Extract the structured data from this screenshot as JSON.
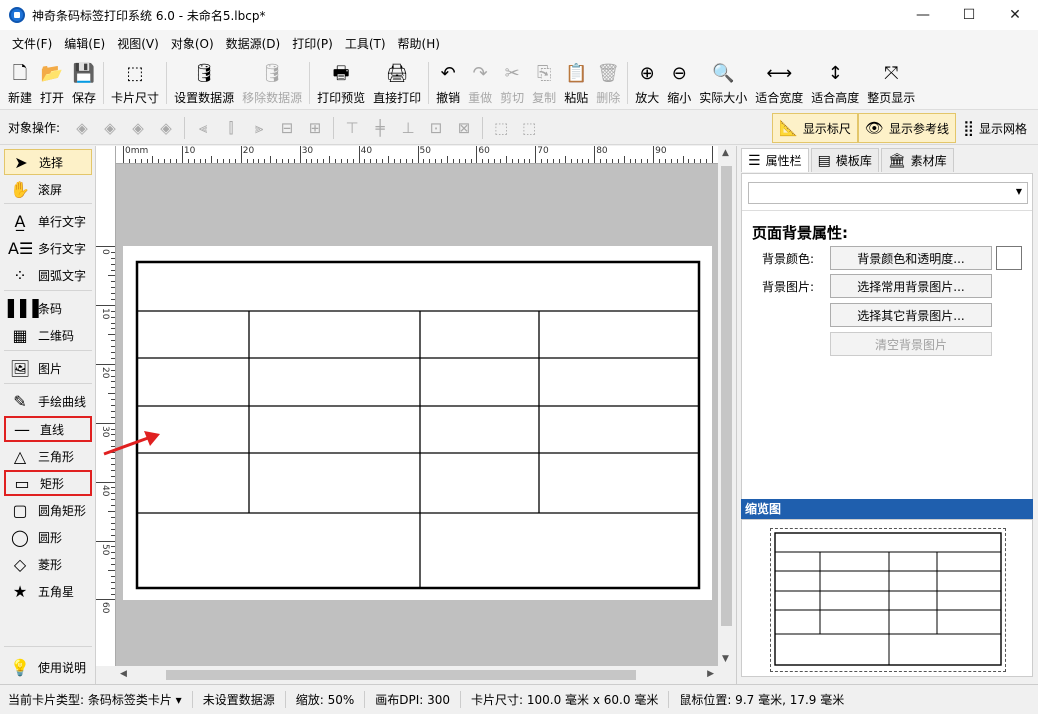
{
  "window": {
    "title": "神奇条码标签打印系统 6.0 - 未命名5.lbcp*",
    "minimize": "—",
    "maximize": "☐",
    "close": "✕"
  },
  "menu": [
    "文件(F)",
    "编辑(E)",
    "视图(V)",
    "对象(O)",
    "数据源(D)",
    "打印(P)",
    "工具(T)",
    "帮助(H)"
  ],
  "toolbar": [
    {
      "label": "新建",
      "icon": "new-file-icon",
      "glyph": "🗋",
      "enabled": true
    },
    {
      "label": "打开",
      "icon": "open-folder-icon",
      "glyph": "📂",
      "enabled": true
    },
    {
      "label": "保存",
      "icon": "save-icon",
      "glyph": "💾",
      "enabled": true
    },
    {
      "label": "卡片尺寸",
      "icon": "card-size-icon",
      "glyph": "⬚",
      "enabled": true
    },
    {
      "label": "设置数据源",
      "icon": "database-icon",
      "glyph": "🛢",
      "enabled": true
    },
    {
      "label": "移除数据源",
      "icon": "remove-database-icon",
      "glyph": "🛢",
      "enabled": false
    },
    {
      "label": "打印预览",
      "icon": "print-preview-icon",
      "glyph": "🖶",
      "enabled": true
    },
    {
      "label": "直接打印",
      "icon": "printer-icon",
      "glyph": "🖨",
      "enabled": true
    },
    {
      "label": "撤销",
      "icon": "undo-icon",
      "glyph": "↶",
      "enabled": true
    },
    {
      "label": "重做",
      "icon": "redo-icon",
      "glyph": "↷",
      "enabled": false
    },
    {
      "label": "剪切",
      "icon": "cut-icon",
      "glyph": "✂",
      "enabled": false
    },
    {
      "label": "复制",
      "icon": "copy-icon",
      "glyph": "⎘",
      "enabled": false
    },
    {
      "label": "粘贴",
      "icon": "paste-icon",
      "glyph": "📋",
      "enabled": true
    },
    {
      "label": "删除",
      "icon": "delete-icon",
      "glyph": "🗑",
      "enabled": false
    },
    {
      "label": "放大",
      "icon": "zoom-in-icon",
      "glyph": "⊕",
      "enabled": true
    },
    {
      "label": "缩小",
      "icon": "zoom-out-icon",
      "glyph": "⊖",
      "enabled": true
    },
    {
      "label": "实际大小",
      "icon": "actual-size-icon",
      "glyph": "🔍",
      "enabled": true
    },
    {
      "label": "适合宽度",
      "icon": "fit-width-icon",
      "glyph": "⟷",
      "enabled": true
    },
    {
      "label": "适合高度",
      "icon": "fit-height-icon",
      "glyph": "↕",
      "enabled": true
    },
    {
      "label": "整页显示",
      "icon": "fit-page-icon",
      "glyph": "⤧",
      "enabled": true
    }
  ],
  "ops": {
    "label": "对象操作:",
    "toggles": [
      {
        "label": "显示标尺",
        "icon": "ruler-icon",
        "glyph": "📐",
        "on": true
      },
      {
        "label": "显示参考线",
        "icon": "eye-icon",
        "glyph": "👁",
        "on": true
      },
      {
        "label": "显示网格",
        "icon": "grid-icon",
        "glyph": "⣿",
        "on": false
      }
    ]
  },
  "tools": [
    {
      "label": "选择",
      "icon": "cursor-icon",
      "glyph": "➤",
      "selected": true
    },
    {
      "label": "滚屏",
      "icon": "hand-icon",
      "glyph": "✋"
    },
    {
      "label": "单行文字",
      "icon": "single-text-icon",
      "glyph": "A̲"
    },
    {
      "label": "多行文字",
      "icon": "multi-text-icon",
      "glyph": "A☰"
    },
    {
      "label": "圆弧文字",
      "icon": "arc-text-icon",
      "glyph": "⁘"
    },
    {
      "label": "条码",
      "icon": "barcode-icon",
      "glyph": "▌▌▌"
    },
    {
      "label": "二维码",
      "icon": "qrcode-icon",
      "glyph": "▦"
    },
    {
      "label": "图片",
      "icon": "image-icon",
      "glyph": "🖼"
    },
    {
      "label": "手绘曲线",
      "icon": "pen-icon",
      "glyph": "✎"
    },
    {
      "label": "直线",
      "icon": "line-icon",
      "glyph": "—",
      "boxed": true
    },
    {
      "label": "三角形",
      "icon": "triangle-icon",
      "glyph": "△"
    },
    {
      "label": "矩形",
      "icon": "rectangle-icon",
      "glyph": "▭",
      "boxed": true
    },
    {
      "label": "圆角矩形",
      "icon": "rounded-rect-icon",
      "glyph": "▢"
    },
    {
      "label": "圆形",
      "icon": "circle-icon",
      "glyph": "◯"
    },
    {
      "label": "菱形",
      "icon": "diamond-icon",
      "glyph": "◇"
    },
    {
      "label": "五角星",
      "icon": "star-icon",
      "glyph": "★"
    },
    {
      "label": "使用说明",
      "icon": "lightbulb-icon",
      "glyph": "💡"
    }
  ],
  "ruler": {
    "h_labels": [
      "0mm",
      "10",
      "20",
      "30",
      "40",
      "50",
      "60",
      "70",
      "80",
      "90"
    ],
    "v_labels": [
      "0",
      "10",
      "20",
      "30",
      "40",
      "50",
      "60"
    ]
  },
  "right": {
    "tabs": [
      {
        "label": "属性栏",
        "icon": "list-icon",
        "glyph": "☰",
        "active": true
      },
      {
        "label": "模板库",
        "icon": "template-icon",
        "glyph": "▤"
      },
      {
        "label": "素材库",
        "icon": "library-icon",
        "glyph": "🏛"
      }
    ],
    "prop_title": "页面背景属性:",
    "bg_color_label": "背景颜色:",
    "bg_image_label": "背景图片:",
    "btn_bg_color": "背景颜色和透明度...",
    "btn_common_bg": "选择常用背景图片...",
    "btn_other_bg": "选择其它背景图片...",
    "btn_clear_bg": "清空背景图片",
    "preview_title": "缩览图"
  },
  "status": {
    "card_type": "当前卡片类型: 条码标签类卡片 ▾",
    "datasource": "未设置数据源",
    "zoom": "缩放: 50%",
    "dpi": "画布DPI: 300",
    "card_size": "卡片尺寸: 100.0 毫米 x 60.0 毫米",
    "mouse_pos": "鼠标位置: 9.7 毫米, 17.9 毫米"
  },
  "colors": {
    "accent_toggle": "#fdf1c8",
    "highlight_box": "#e02020",
    "preview_header": "#1f5fae",
    "arrow": "#e02020"
  }
}
